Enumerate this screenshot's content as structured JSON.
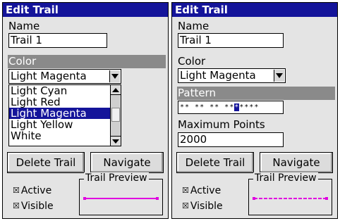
{
  "left": {
    "title": "Edit Trail",
    "name_label": "Name",
    "name_value": "Trail 1",
    "color_label": "Color",
    "color_value": "Light Magenta",
    "color_options": [
      "Light Cyan",
      "Light Red",
      "Light Magenta",
      "Light Yellow",
      "White"
    ],
    "selected_option": "Light Magenta",
    "delete_label": "Delete Trail",
    "navigate_label": "Navigate",
    "active_label": "Active",
    "visible_label": "Visible",
    "preview_title": "Trail Preview"
  },
  "right": {
    "title": "Edit Trail",
    "name_label": "Name",
    "name_value": "Trail 1",
    "color_label": "Color",
    "color_value": "Light Magenta",
    "pattern_label": "Pattern",
    "pattern_before": "** ** ** **",
    "pattern_cursor": "*",
    "pattern_after": "****",
    "max_points_label": "Maximum Points",
    "max_points_value": "2000",
    "delete_label": "Delete Trail",
    "navigate_label": "Navigate",
    "active_label": "Active",
    "visible_label": "Visible",
    "preview_title": "Trail Preview"
  },
  "checkbox_mark": "☒",
  "colors": {
    "title_bar": "#14149a",
    "selection": "#14149a",
    "trail_line": "#e000e0",
    "panel_bg": "#e4e4e4",
    "highlight_label": "#8a8a8a"
  },
  "icons": {
    "dropdown": "triangle-down",
    "scroll_up": "triangle-up",
    "scroll_down": "triangle-down",
    "checkbox": "checked-box"
  }
}
